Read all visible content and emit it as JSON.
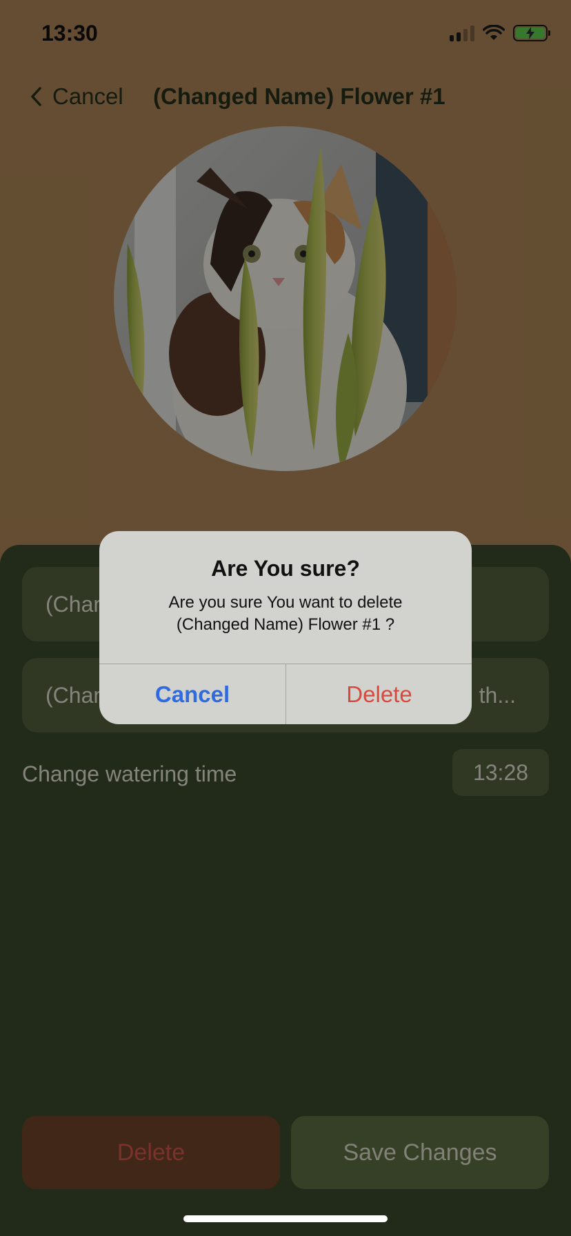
{
  "status_bar": {
    "time": "13:30",
    "icons": [
      "cellular-signal-icon",
      "wifi-icon",
      "battery-charging-icon"
    ]
  },
  "nav": {
    "back_label": "Cancel",
    "back_icon": "chevron-left-icon",
    "title": "(Changed Name) Flower #1"
  },
  "photo": {
    "subject": "cat-behind-plant"
  },
  "form": {
    "name_field_value": "(Chan",
    "description_field_value": "(Chan",
    "description_field_tail": "th...",
    "watering_label": "Change watering time",
    "watering_time": "13:28"
  },
  "actions": {
    "delete_label": "Delete",
    "save_label": "Save Changes"
  },
  "alert": {
    "title": "Are You sure?",
    "message_line1": "Are you sure You want to delete",
    "message_line2": "(Changed Name) Flower #1 ?",
    "cancel_label": "Cancel",
    "delete_label": "Delete"
  },
  "colors": {
    "background": "#ad8656",
    "panel": "#3b4a2c",
    "field": "#54613f",
    "destructive": "#d9483c",
    "alert_accent": "#2f6be0"
  }
}
